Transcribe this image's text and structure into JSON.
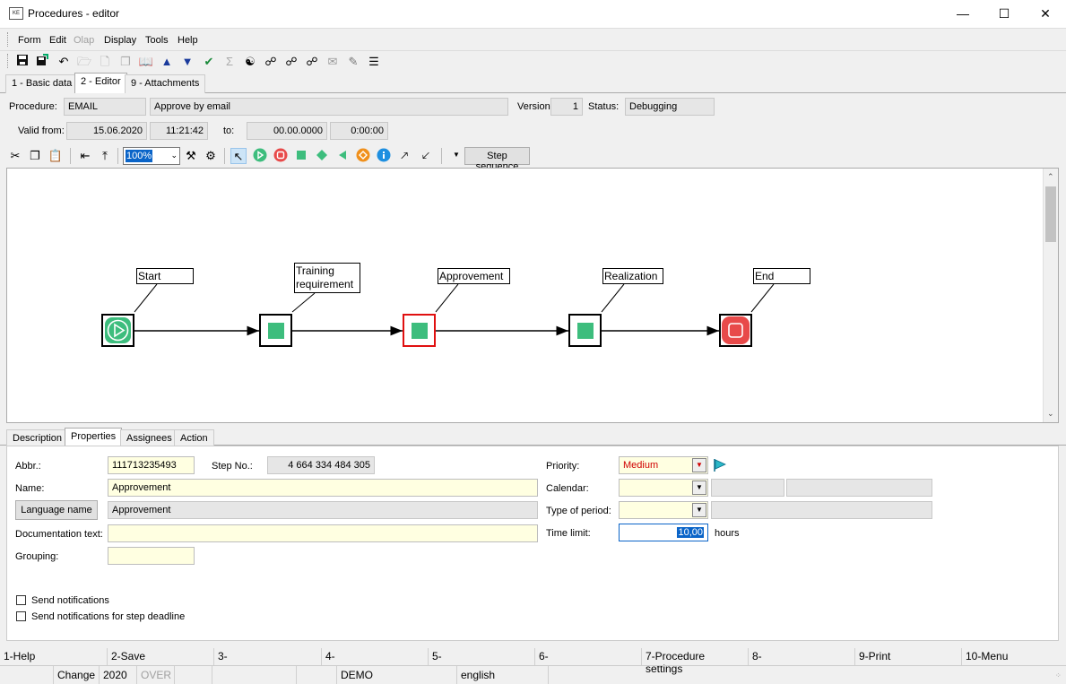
{
  "window": {
    "title": "Procedures - editor",
    "app_icon_text": "KE"
  },
  "menu": [
    "Form",
    "Edit",
    "Olap",
    "Display",
    "Tools",
    "Help"
  ],
  "tabs": [
    "1 - Basic data",
    "2 - Editor",
    "9 - Attachments"
  ],
  "header": {
    "procedure_label": "Procedure:",
    "procedure_code": "EMAIL",
    "procedure_name": "Approve by email",
    "version_label": "Version:",
    "version": "1",
    "status_label": "Status:",
    "status": "Debugging",
    "valid_from_label": "Valid from:",
    "valid_from_date": "15.06.2020",
    "valid_from_time": "11:21:42",
    "to_label": "to:",
    "to_date": "00.00.0000",
    "to_time": "0:00:00"
  },
  "editor_toolbar": {
    "zoom": "100%",
    "step_sequence": "Step sequence"
  },
  "diagram": {
    "nodes": [
      {
        "label_line1": "Start",
        "label_line2": "",
        "kind": "start"
      },
      {
        "label_line1": "Training",
        "label_line2": "requirement",
        "kind": "step"
      },
      {
        "label_line1": "Approvement",
        "label_line2": "",
        "kind": "step-selected"
      },
      {
        "label_line1": "Realization",
        "label_line2": "",
        "kind": "step"
      },
      {
        "label_line1": "End",
        "label_line2": "",
        "kind": "end"
      }
    ]
  },
  "bottom_tabs": [
    "Description",
    "Properties",
    "Assignees",
    "Action"
  ],
  "properties": {
    "abbr_label": "Abbr.:",
    "abbr": "111713235493",
    "step_no_label": "Step No.:",
    "step_no": "4 664 334 484 305",
    "name_label": "Name:",
    "name": "Approvement",
    "language_name_button": "Language name",
    "language_name": "Approvement",
    "documentation_label": "Documentation text:",
    "documentation": "",
    "grouping_label": "Grouping:",
    "grouping": "",
    "priority_label": "Priority:",
    "priority": "Medium",
    "calendar_label": "Calendar:",
    "calendar": "",
    "type_of_period_label": "Type of period:",
    "type_of_period": "",
    "time_limit_label": "Time limit:",
    "time_limit": "10,00",
    "time_limit_unit": "hours",
    "send_notifications": "Send notifications",
    "send_notifications_deadline": "Send notifications for step deadline"
  },
  "fkeys": [
    "1-Help",
    "2-Save",
    "3-",
    "4-",
    "5-",
    "6-",
    "7-Procedure settings",
    "8-",
    "9-Print",
    "10-Menu"
  ],
  "status": {
    "mode": "Change",
    "year": "2020",
    "over": "OVER",
    "db": "DEMO",
    "lang": "english"
  },
  "colors": {
    "green": "#3dbd7d",
    "red": "#e84a4a",
    "selected_border": "#e01010",
    "field_yellow": "#ffffe1",
    "priority_text": "#d00000"
  }
}
